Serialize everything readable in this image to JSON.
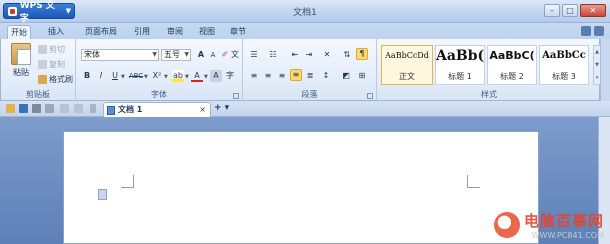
{
  "app": {
    "menu_label": "WPS 文字",
    "document_title": "文档1"
  },
  "window_controls": [
    "–",
    "□",
    "✕"
  ],
  "tabs": [
    {
      "label": "开始",
      "active": true
    },
    {
      "label": "插入"
    },
    {
      "label": "页面布局"
    },
    {
      "label": "引用"
    },
    {
      "label": "审阅"
    },
    {
      "label": "视图"
    },
    {
      "label": "章节"
    }
  ],
  "ribbon": {
    "clipboard": {
      "paste_label": "粘贴",
      "cut_label": "剪切",
      "copy_label": "复制",
      "format_painter_label": "格式刷",
      "group_label": "剪贴板"
    },
    "font": {
      "font_name": "宋体",
      "font_size": "五号",
      "grow_label": "A",
      "shrink_label": "A",
      "clear_label": "✐",
      "wen_label": "文",
      "bold": "B",
      "italic": "I",
      "underline": "U",
      "strike": "ABC",
      "superscript": "X²",
      "highlight": "ab",
      "font_color": "A",
      "char_shade": "A",
      "phonetic": "字",
      "group_label": "字体"
    },
    "paragraph": {
      "group_label": "段落"
    },
    "styles": {
      "items": [
        {
          "sample": "AaBbCcDd",
          "name": "正文",
          "active": true
        },
        {
          "sample": "AaBb(",
          "name": "标题 1"
        },
        {
          "sample": "AaBbC(",
          "name": "标题 2"
        },
        {
          "sample": "AaBbCc",
          "name": "标题 3"
        }
      ],
      "group_label": "样式"
    }
  },
  "document_tab": {
    "label": "文档 1",
    "close": "×",
    "new_tab": "+ ▾"
  },
  "watermark": {
    "brand": "电脑百事网",
    "url": "WWW.PC841.COM"
  },
  "colors": {
    "accent": "#1a58b4",
    "ribbon_bg": "#e6eefa",
    "workspace": "#6d8fc4",
    "highlight": "#ffd96b"
  }
}
